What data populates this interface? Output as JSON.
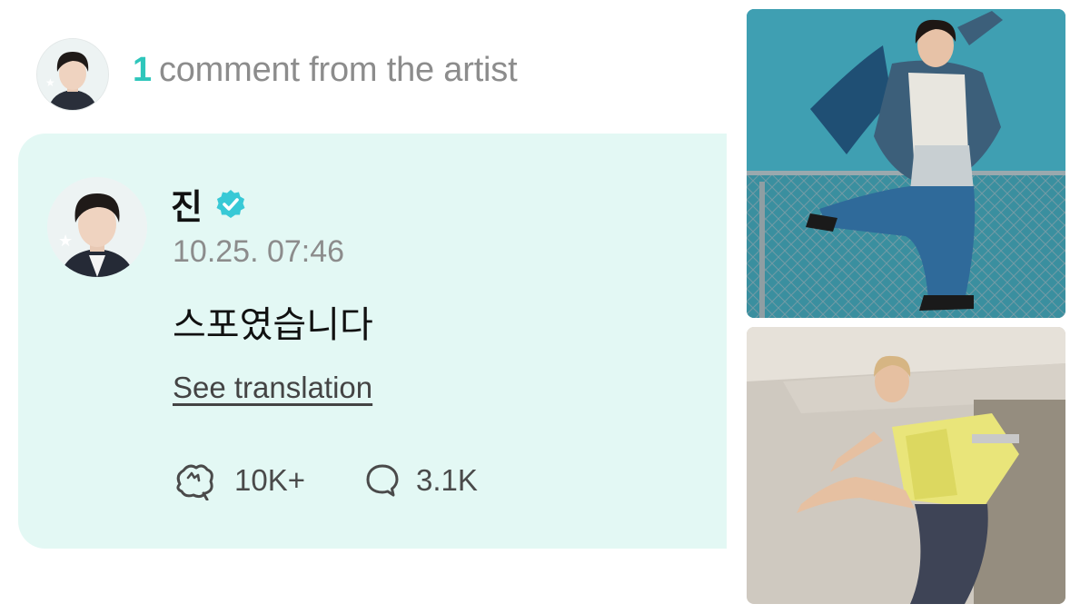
{
  "header": {
    "count": "1",
    "label": "comment from the artist"
  },
  "comment": {
    "author": "진",
    "verified_icon": "verified-check-badge",
    "timestamp": "10.25. 07:46",
    "text": "스포였습니다",
    "see_translation": "See translation",
    "reactions": {
      "likes": "10K+",
      "replies": "3.1K"
    }
  },
  "colors": {
    "accent": "#2ec6bb",
    "card_background": "#e3f8f4",
    "muted_text": "#8c8c8c"
  }
}
